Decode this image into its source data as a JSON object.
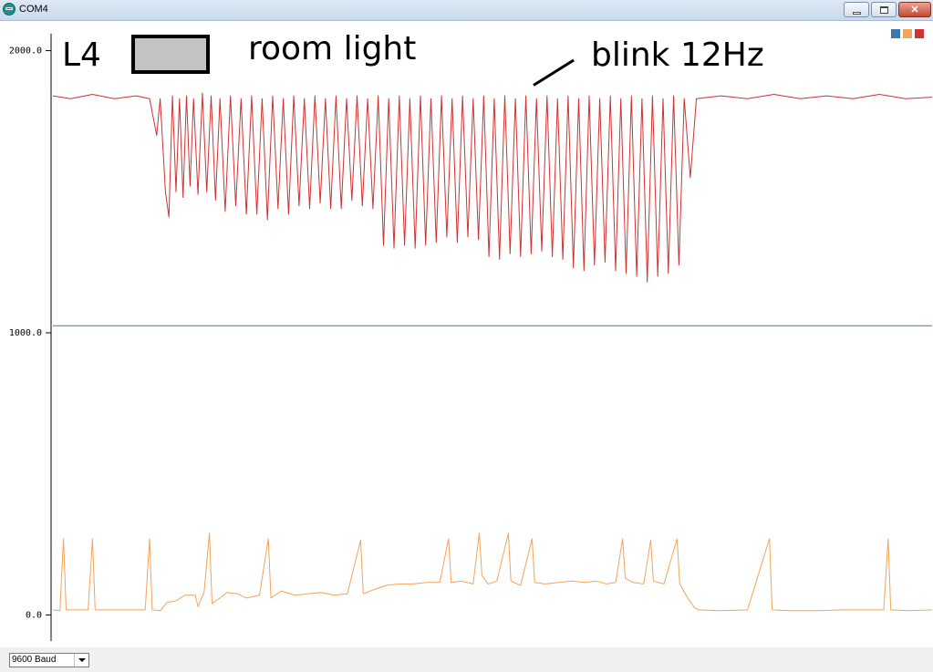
{
  "window": {
    "title": "COM4"
  },
  "annotations": {
    "l4": "L4",
    "room": "room light",
    "blink": "blink 12Hz"
  },
  "footer": {
    "baud": "9600 Baud"
  },
  "chart_data": {
    "type": "line",
    "ylim": [
      -60,
      2060
    ],
    "yticks": [
      {
        "v": 2000,
        "label": "2000.0"
      },
      {
        "v": 1000,
        "label": "1000.0"
      },
      {
        "v": 0,
        "label": "0.0"
      }
    ],
    "xlim": [
      0,
      1000
    ],
    "grid": false,
    "legend": "top-right",
    "series": [
      {
        "color": "#3a78b0",
        "values": [
          [
            0,
            1025
          ],
          [
            1000,
            1025
          ]
        ]
      },
      {
        "color": "#f2a45a",
        "values": [
          [
            0,
            18
          ],
          [
            8,
            15
          ],
          [
            12,
            270
          ],
          [
            15,
            18
          ],
          [
            40,
            18
          ],
          [
            45,
            270
          ],
          [
            48,
            18
          ],
          [
            105,
            18
          ],
          [
            110,
            270
          ],
          [
            113,
            18
          ],
          [
            122,
            15
          ],
          [
            130,
            45
          ],
          [
            140,
            50
          ],
          [
            150,
            70
          ],
          [
            162,
            70
          ],
          [
            165,
            30
          ],
          [
            172,
            80
          ],
          [
            178,
            290
          ],
          [
            181,
            40
          ],
          [
            190,
            60
          ],
          [
            198,
            80
          ],
          [
            210,
            75
          ],
          [
            220,
            60
          ],
          [
            235,
            70
          ],
          [
            245,
            270
          ],
          [
            248,
            60
          ],
          [
            260,
            85
          ],
          [
            275,
            70
          ],
          [
            290,
            75
          ],
          [
            305,
            80
          ],
          [
            320,
            70
          ],
          [
            335,
            75
          ],
          [
            350,
            265
          ],
          [
            353,
            75
          ],
          [
            365,
            90
          ],
          [
            380,
            105
          ],
          [
            395,
            110
          ],
          [
            410,
            110
          ],
          [
            425,
            115
          ],
          [
            440,
            115
          ],
          [
            450,
            270
          ],
          [
            453,
            115
          ],
          [
            465,
            120
          ],
          [
            478,
            110
          ],
          [
            485,
            290
          ],
          [
            488,
            140
          ],
          [
            495,
            110
          ],
          [
            505,
            120
          ],
          [
            518,
            290
          ],
          [
            521,
            120
          ],
          [
            532,
            105
          ],
          [
            545,
            270
          ],
          [
            548,
            115
          ],
          [
            560,
            110
          ],
          [
            575,
            115
          ],
          [
            590,
            120
          ],
          [
            605,
            115
          ],
          [
            618,
            120
          ],
          [
            630,
            110
          ],
          [
            640,
            115
          ],
          [
            648,
            270
          ],
          [
            651,
            130
          ],
          [
            660,
            115
          ],
          [
            672,
            110
          ],
          [
            680,
            265
          ],
          [
            683,
            120
          ],
          [
            695,
            110
          ],
          [
            710,
            270
          ],
          [
            713,
            110
          ],
          [
            722,
            60
          ],
          [
            730,
            25
          ],
          [
            735,
            18
          ],
          [
            760,
            15
          ],
          [
            790,
            18
          ],
          [
            815,
            270
          ],
          [
            818,
            18
          ],
          [
            840,
            15
          ],
          [
            870,
            15
          ],
          [
            900,
            18
          ],
          [
            945,
            18
          ],
          [
            950,
            270
          ],
          [
            953,
            18
          ],
          [
            975,
            15
          ],
          [
            1000,
            18
          ]
        ]
      },
      {
        "color": "#d03232",
        "values": [
          [
            0,
            1840
          ],
          [
            20,
            1830
          ],
          [
            45,
            1845
          ],
          [
            70,
            1830
          ],
          [
            95,
            1840
          ],
          [
            110,
            1830
          ],
          [
            118,
            1700
          ],
          [
            122,
            1830
          ],
          [
            128,
            1500
          ],
          [
            132,
            1410
          ],
          [
            136,
            1840
          ],
          [
            140,
            1500
          ],
          [
            144,
            1830
          ],
          [
            148,
            1480
          ],
          [
            152,
            1840
          ],
          [
            156,
            1520
          ],
          [
            160,
            1830
          ],
          [
            165,
            1490
          ],
          [
            170,
            1850
          ],
          [
            175,
            1500
          ],
          [
            180,
            1840
          ],
          [
            185,
            1470
          ],
          [
            190,
            1830
          ],
          [
            196,
            1430
          ],
          [
            202,
            1840
          ],
          [
            208,
            1450
          ],
          [
            214,
            1830
          ],
          [
            220,
            1420
          ],
          [
            226,
            1840
          ],
          [
            232,
            1420
          ],
          [
            238,
            1830
          ],
          [
            244,
            1400
          ],
          [
            250,
            1840
          ],
          [
            256,
            1440
          ],
          [
            262,
            1830
          ],
          [
            268,
            1420
          ],
          [
            274,
            1840
          ],
          [
            280,
            1450
          ],
          [
            286,
            1830
          ],
          [
            292,
            1440
          ],
          [
            298,
            1840
          ],
          [
            304,
            1460
          ],
          [
            310,
            1830
          ],
          [
            316,
            1440
          ],
          [
            322,
            1840
          ],
          [
            328,
            1440
          ],
          [
            334,
            1830
          ],
          [
            340,
            1470
          ],
          [
            346,
            1840
          ],
          [
            352,
            1450
          ],
          [
            358,
            1830
          ],
          [
            364,
            1440
          ],
          [
            370,
            1840
          ],
          [
            376,
            1310
          ],
          [
            382,
            1830
          ],
          [
            388,
            1300
          ],
          [
            394,
            1840
          ],
          [
            400,
            1310
          ],
          [
            406,
            1830
          ],
          [
            412,
            1300
          ],
          [
            418,
            1840
          ],
          [
            424,
            1310
          ],
          [
            430,
            1830
          ],
          [
            436,
            1320
          ],
          [
            442,
            1840
          ],
          [
            448,
            1340
          ],
          [
            454,
            1830
          ],
          [
            460,
            1320
          ],
          [
            466,
            1840
          ],
          [
            472,
            1340
          ],
          [
            478,
            1830
          ],
          [
            484,
            1330
          ],
          [
            490,
            1840
          ],
          [
            496,
            1270
          ],
          [
            502,
            1830
          ],
          [
            508,
            1260
          ],
          [
            514,
            1840
          ],
          [
            520,
            1280
          ],
          [
            526,
            1830
          ],
          [
            532,
            1270
          ],
          [
            538,
            1840
          ],
          [
            544,
            1280
          ],
          [
            550,
            1830
          ],
          [
            556,
            1290
          ],
          [
            562,
            1840
          ],
          [
            568,
            1270
          ],
          [
            574,
            1830
          ],
          [
            580,
            1260
          ],
          [
            586,
            1840
          ],
          [
            592,
            1230
          ],
          [
            598,
            1830
          ],
          [
            604,
            1220
          ],
          [
            610,
            1840
          ],
          [
            616,
            1240
          ],
          [
            622,
            1830
          ],
          [
            628,
            1250
          ],
          [
            634,
            1840
          ],
          [
            640,
            1220
          ],
          [
            646,
            1830
          ],
          [
            652,
            1210
          ],
          [
            658,
            1840
          ],
          [
            664,
            1200
          ],
          [
            670,
            1830
          ],
          [
            676,
            1180
          ],
          [
            682,
            1840
          ],
          [
            688,
            1200
          ],
          [
            694,
            1830
          ],
          [
            700,
            1210
          ],
          [
            706,
            1840
          ],
          [
            712,
            1240
          ],
          [
            718,
            1830
          ],
          [
            725,
            1550
          ],
          [
            732,
            1830
          ],
          [
            760,
            1840
          ],
          [
            790,
            1830
          ],
          [
            820,
            1845
          ],
          [
            850,
            1830
          ],
          [
            880,
            1840
          ],
          [
            910,
            1830
          ],
          [
            940,
            1845
          ],
          [
            970,
            1830
          ],
          [
            1000,
            1835
          ]
        ]
      }
    ]
  }
}
